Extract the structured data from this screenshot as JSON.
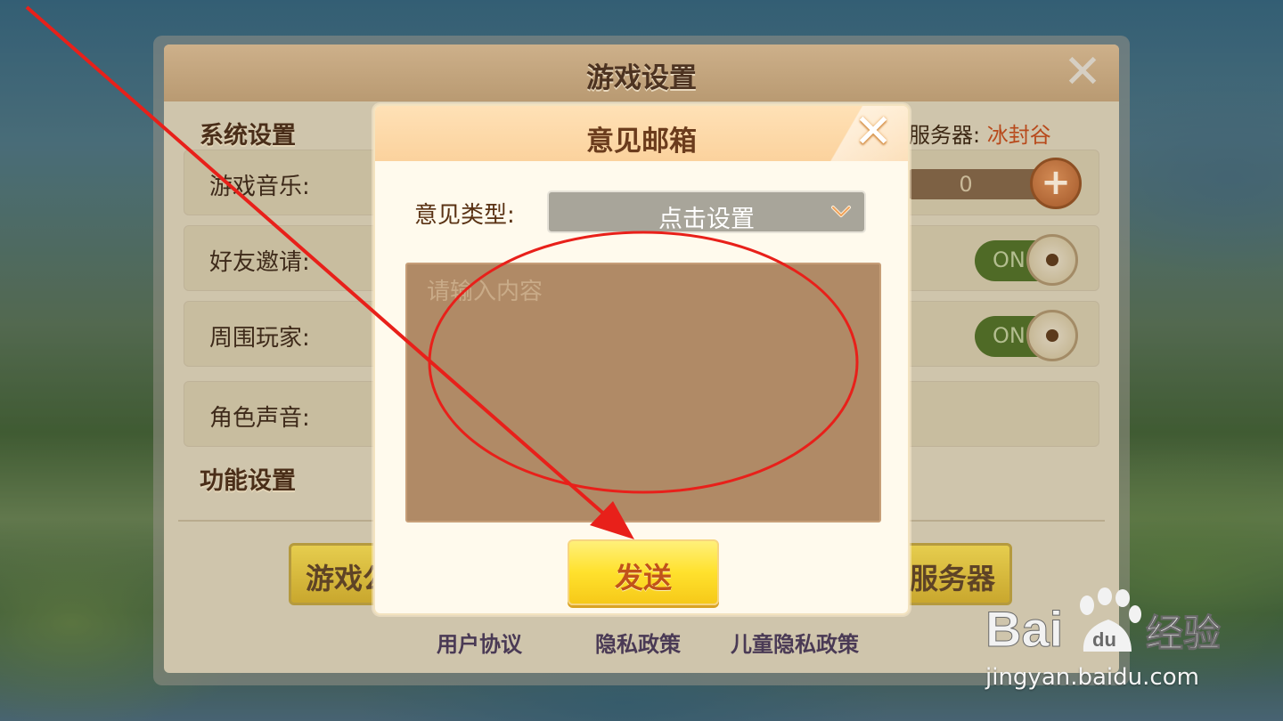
{
  "settings": {
    "title": "游戏设置",
    "close_icon": "close-icon",
    "system_heading": "系统设置",
    "server_label": "服务器:",
    "server_value": "冰封谷",
    "rows": [
      {
        "label": "游戏音乐:"
      },
      {
        "label": "好友邀请:"
      },
      {
        "label": "周围玩家:"
      },
      {
        "label": "角色声音:"
      }
    ],
    "music_volume": "0",
    "toggle_on_label": "ON",
    "function_heading": "功能设置",
    "left_button_label": "游戏公",
    "right_button_label": "服务器",
    "footer_links": [
      "用户协议",
      "隐私政策",
      "儿童隐私政策"
    ]
  },
  "modal": {
    "title": "意见邮箱",
    "close_icon": "close-icon",
    "type_label": "意见类型:",
    "type_selected": "点击设置",
    "content_placeholder": "请输入内容",
    "content_value": "",
    "send_label": "发送"
  },
  "watermark": {
    "logo_text_bai": "Bai",
    "logo_text_du": "du",
    "logo_text_cn": "经验",
    "url": "jingyan.baidu.com"
  },
  "colors": {
    "annotation_red": "#e8201a",
    "modal_header": "#fbd29d",
    "send_button": "#ffe12d",
    "toggle_on": "#4f6a26"
  }
}
